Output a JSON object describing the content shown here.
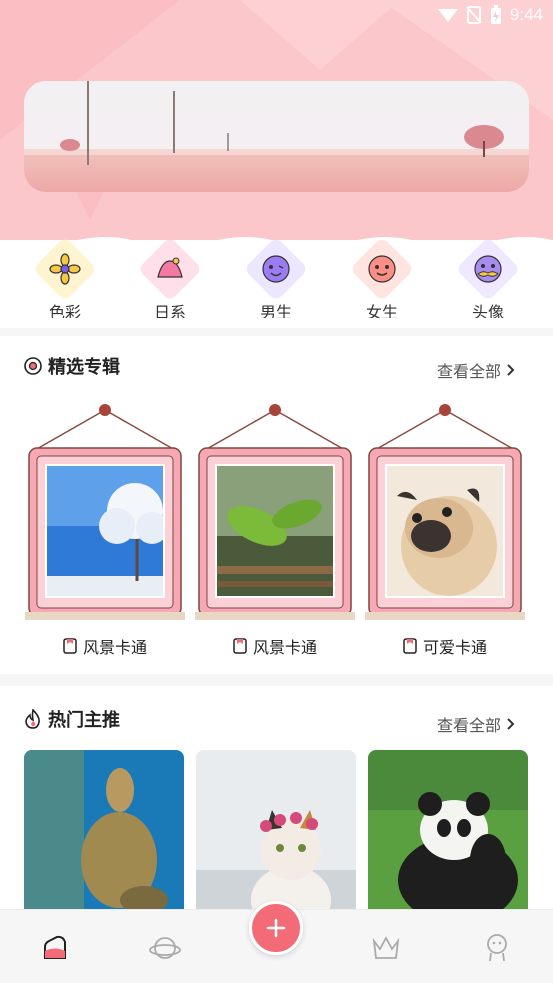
{
  "status_bar": {
    "time": "9:44"
  },
  "categories": [
    {
      "label": "色彩",
      "icon": "flower-icon",
      "bg": "#fff4d0"
    },
    {
      "label": "日系",
      "icon": "mountain-icon",
      "bg": "#ffe0ea"
    },
    {
      "label": "男生",
      "icon": "boy-face-icon",
      "bg": "#ece6ff"
    },
    {
      "label": "女生",
      "icon": "girl-face-icon",
      "bg": "#ffe4e0"
    },
    {
      "label": "头像",
      "icon": "mustache-face-icon",
      "bg": "#f0e8ff"
    }
  ],
  "featured": {
    "title": "精选专辑",
    "see_all": "查看全部",
    "albums": [
      {
        "label": "风景卡通",
        "photo": "snowy-tree"
      },
      {
        "label": "风景卡通",
        "photo": "green-sprout"
      },
      {
        "label": "可爱卡通",
        "photo": "pug-dog"
      }
    ]
  },
  "hot": {
    "title": "热门主推",
    "see_all": "查看全部",
    "cards": [
      {
        "photo": "sea-turtle"
      },
      {
        "photo": "cat-flower-crown"
      },
      {
        "photo": "panda"
      }
    ]
  },
  "bottom_nav": {
    "items": [
      "home-icon",
      "planet-icon",
      "add-icon",
      "crown-icon",
      "profile-icon"
    ],
    "accent": "#f36b76"
  },
  "colors": {
    "header_pink": "#fcc7cb",
    "accent": "#f36b76"
  }
}
